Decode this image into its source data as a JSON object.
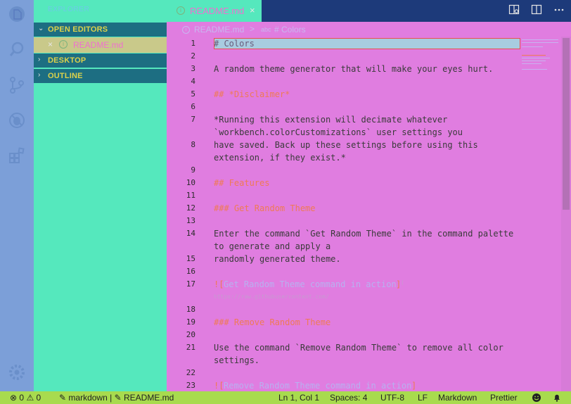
{
  "sidebar": {
    "title": "EXPLORER",
    "sections": [
      {
        "label": "OPEN EDITORS",
        "expanded": true
      },
      {
        "label": "DESKTOP",
        "expanded": false
      },
      {
        "label": "OUTLINE",
        "expanded": false
      }
    ],
    "open_editors": [
      {
        "name": "README.md"
      }
    ]
  },
  "tab": {
    "name": "README.md"
  },
  "breadcrumb": {
    "file": "README.md",
    "separator": ">",
    "symbol_icon": "abc",
    "symbol": "# Colors"
  },
  "editor": {
    "line_numbers": [
      "1",
      "2",
      "3",
      "4",
      "5",
      "6",
      "7",
      "8",
      "9",
      "10",
      "11",
      "12",
      "13",
      "14",
      "15",
      "16",
      "17",
      "18",
      "19",
      "20",
      "21",
      "22",
      "23"
    ],
    "lines": [
      "# Colors",
      "A random theme generator that will make your eyes hurt.",
      "## *Disclaimer*",
      "*Running this extension will decimate whatever",
      "`workbench.colorCustomizations` user settings you",
      "have saved. Back up these settings before using this",
      "extension, if they exist.*",
      "## Features",
      "### Get Random Theme",
      "Enter the command `Get Random Theme` in the command palette",
      "to generate and apply a",
      "randomly generated theme.",
      "![",
      "Get Random Theme command in action",
      "]",
      "(",
      "https://raw.githubusercontent.com/",
      "### Remove Random Theme",
      "Use the command `Remove Random Theme` to remove all color",
      "settings.",
      "![",
      "Remove Random Theme command in action",
      "]"
    ]
  },
  "statusbar": {
    "errors": "0",
    "warnings": "0",
    "language_mode": "markdown",
    "separator": "|",
    "file": "README.md",
    "position": "Ln 1, Col 1",
    "spaces": "Spaces: 4",
    "encoding": "UTF-8",
    "eol": "LF",
    "language": "Markdown",
    "formatter": "Prettier"
  },
  "colors": {
    "editor_bg": "#e07de0",
    "sidebar_bg": "#55e8bd",
    "activity_bar_bg": "#7c9fd8",
    "tabbar_bg": "#1d3a7a",
    "statusbar_bg": "#a8db4e",
    "section_header_bg": "#1d6e82",
    "section_header_fg": "#ddd24a",
    "heading_fg": "#ef7a55",
    "link_fg": "#b8b0f0",
    "text_fg": "#3a3a3a"
  },
  "icons": {
    "activity": [
      "files-icon",
      "search-icon",
      "source-control-icon",
      "debug-icon",
      "extensions-icon",
      "settings-gear-icon"
    ],
    "editor_actions": [
      "open-preview-icon",
      "split-editor-icon",
      "more-actions-icon"
    ],
    "status_right": [
      "feedback-smiley-icon",
      "notifications-bell-icon"
    ]
  }
}
